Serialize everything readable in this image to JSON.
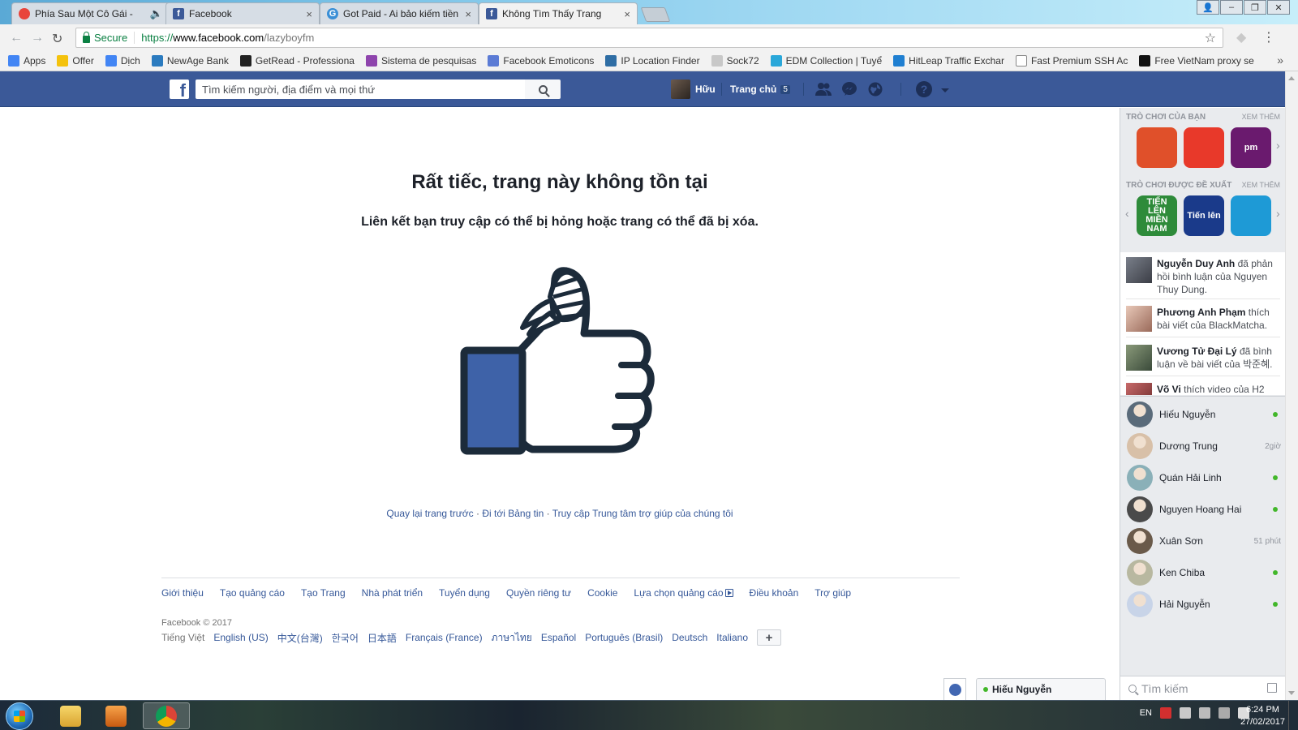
{
  "browser": {
    "tabs": [
      {
        "title": "Phía Sau Một Cô Gái -",
        "icon": "google-music-icon",
        "color": "#e8453c",
        "close": "",
        "speaker": "🔈"
      },
      {
        "title": "Facebook",
        "icon": "facebook-icon",
        "color": "#3b5998",
        "close": "×"
      },
      {
        "title": "Got Paid - Ai bảo kiếm tiền",
        "icon": "gotpaid-icon",
        "color": "#3a8fd6",
        "close": "×"
      },
      {
        "title": "Không Tìm Thấy Trang",
        "icon": "facebook-icon",
        "color": "#3b5998",
        "close": "×"
      }
    ],
    "address": {
      "secure_label": "Secure",
      "scheme": "https://",
      "host": "www.facebook.com",
      "path": "/lazyboyfm"
    },
    "bookmarks": [
      {
        "label": "Apps",
        "color": "#4285f4"
      },
      {
        "label": "Offer",
        "color": "#f4c20d"
      },
      {
        "label": "Dịch",
        "color": "#4285f4"
      },
      {
        "label": "NewAge Bank",
        "color": "#2b7bbf"
      },
      {
        "label": "GetRead - Professiona",
        "color": "#222222"
      },
      {
        "label": "Sistema de pesquisas",
        "color": "#8e44ad"
      },
      {
        "label": "Facebook Emoticons",
        "color": "#5b7bd5"
      },
      {
        "label": "IP Location Finder",
        "color": "#2e6da4"
      },
      {
        "label": "Sock72",
        "color": "#c8c8c8"
      },
      {
        "label": "EDM Collection | Tuyể",
        "color": "#2aa7d9"
      },
      {
        "label": "HitLeap Traffic Exchar",
        "color": "#1f7fd1"
      },
      {
        "label": "Fast Premium SSH Ac",
        "color": "#ffffff"
      },
      {
        "label": "Free VietNam proxy se",
        "color": "#111111"
      }
    ],
    "bookmarks_more": "»"
  },
  "fb_header": {
    "logo": "f",
    "search_placeholder": "Tìm kiếm người, địa điểm và mọi thứ",
    "user_name": "Hữu",
    "home_label": "Trang chủ",
    "home_count": "5",
    "help": "?"
  },
  "error": {
    "title": "Rất tiếc, trang này không tồn tại",
    "subtitle": "Liên kết bạn truy cập có thể bị hỏng hoặc trang có thể đã bị xóa.",
    "links": [
      "Quay lại trang trước",
      "Đi tới Bảng tin",
      "Truy cập Trung tâm trợ giúp của chúng tôi"
    ],
    "sep": "·"
  },
  "footer": {
    "links": [
      "Giới thiệu",
      "Tạo quảng cáo",
      "Tạo Trang",
      "Nhà phát triển",
      "Tuyển dụng",
      "Quyền riêng tư",
      "Cookie",
      "Lựa chọn quảng cáo",
      "Điều khoản",
      "Trợ giúp"
    ],
    "copyright": "Facebook © 2017",
    "current_lang": "Tiếng Việt",
    "languages": [
      "English (US)",
      "中文(台灣)",
      "한국어",
      "日本語",
      "Français (France)",
      "ภาษาไทย",
      "Español",
      "Português (Brasil)",
      "Deutsch",
      "Italiano"
    ],
    "add_lang": "+"
  },
  "sidebar": {
    "your_games_title": "TRÒ CHƠI CỦA BẠN",
    "suggested_games_title": "TRÒ CHƠI ĐƯỢC ĐỀ XUẤT",
    "see_more": "XEM THÊM",
    "your_games": [
      {
        "label": "",
        "color": "#e0502a"
      },
      {
        "label": "",
        "color": "#e8392a"
      },
      {
        "label": "pm",
        "color": "#6a1a6e"
      }
    ],
    "suggested_games": [
      {
        "label": "TIẾN LÊN MIỀN NAM",
        "color": "#2e8b3a"
      },
      {
        "label": "Tiến lên",
        "color": "#1a3a8a"
      },
      {
        "label": "",
        "color": "#1e9ad6"
      }
    ],
    "ticker": [
      {
        "name": "Nguyễn Duy Anh",
        "text": "đã phản hồi bình luận của Nguyen Thuy Dung."
      },
      {
        "name": "Phương Anh Phạm",
        "text": "thích bài viết của BlackMatcha."
      },
      {
        "name": "Vương Tử Đại Lý",
        "text": "đã bình luận về bài viết của 박준혜."
      },
      {
        "name": "Võ Vi",
        "text": "thích video của H2"
      }
    ],
    "contacts": [
      {
        "name": "Hiếu Nguyễn",
        "status": "online"
      },
      {
        "name": "Dương Trung",
        "status": "2giờ"
      },
      {
        "name": "Quán Hải Linh",
        "status": "online"
      },
      {
        "name": "Nguyen Hoang Hai",
        "status": "online"
      },
      {
        "name": "Xuân Sơn",
        "status": "51 phút"
      },
      {
        "name": "Ken Chiba",
        "status": "online"
      },
      {
        "name": "Hải Nguyễn",
        "status": "online"
      }
    ],
    "chat_search_placeholder": "Tìm kiếm"
  },
  "chat": {
    "open_tab_name": "Hiếu Nguyễn"
  },
  "taskbar": {
    "lang": "EN",
    "time": "6:24 PM",
    "date": "27/02/2017"
  }
}
